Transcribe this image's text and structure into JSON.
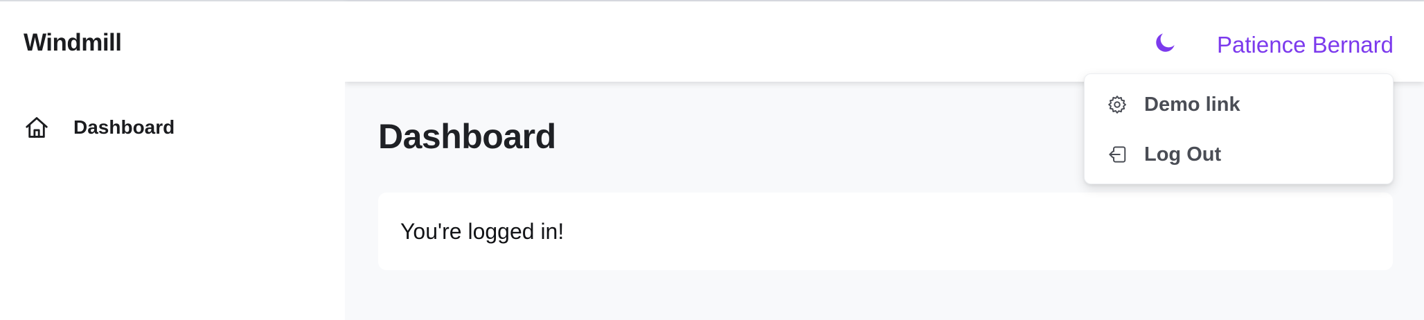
{
  "sidebar": {
    "logo": "Windmill",
    "items": [
      {
        "label": "Dashboard",
        "icon": "home-icon"
      }
    ]
  },
  "header": {
    "theme_icon": "moon-icon",
    "user_name": "Patience Bernard",
    "accent_color": "#7c3aed"
  },
  "user_menu": {
    "items": [
      {
        "label": "Demo link",
        "icon": "gear-icon"
      },
      {
        "label": "Log Out",
        "icon": "logout-icon"
      }
    ]
  },
  "main": {
    "title": "Dashboard",
    "card_text": "You're logged in!"
  }
}
